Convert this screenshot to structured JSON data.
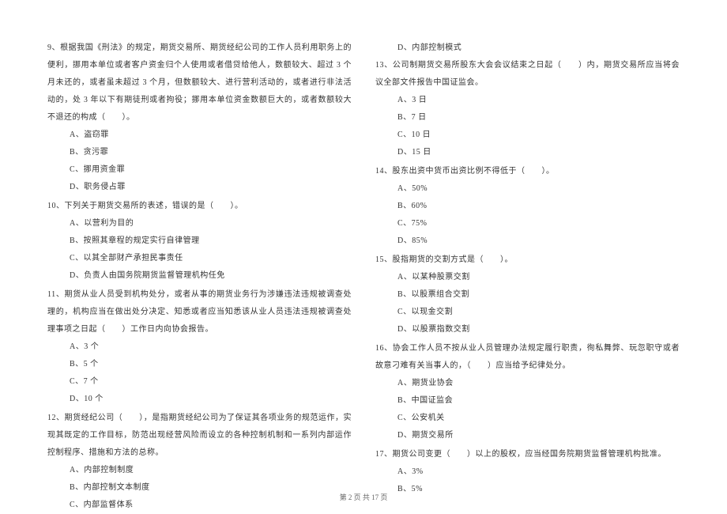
{
  "left_column": {
    "q9": {
      "text": "9、根据我国《刑法》的规定，期货交易所、期货经纪公司的工作人员利用职务上的便利，挪用本单位或者客户资金归个人使用或者借贷给他人，数额较大、超过 3 个月未还的，或者虽未超过 3 个月，但数额较大、进行营利活动的，或者进行非法活动的，处 3 年以下有期徒刑或者拘役；挪用本单位资金数额巨大的，或者数额较大不退还的构成（　　）。",
      "options": {
        "a": "A、盗窃罪",
        "b": "B、贪污罪",
        "c": "C、挪用资金罪",
        "d": "D、职务侵占罪"
      }
    },
    "q10": {
      "text": "10、下列关于期货交易所的表述，错误的是（　　）。",
      "options": {
        "a": "A、以营利为目的",
        "b": "B、按照其章程的规定实行自律管理",
        "c": "C、以其全部财产承担民事责任",
        "d": "D、负责人由国务院期货监督管理机构任免"
      }
    },
    "q11": {
      "text": "11、期货从业人员受到机构处分，或者从事的期货业务行为涉嫌违法违规被调查处理的，机构应当在做出处分决定、知悉或者应当知悉该从业人员违法违规被调查处理事项之日起（　　）工作日内向协会报告。",
      "options": {
        "a": "A、3 个",
        "b": "B、5 个",
        "c": "C、7 个",
        "d": "D、10 个"
      }
    },
    "q12": {
      "text": "12、期货经纪公司（　　），是指期货经纪公司为了保证其各项业务的规范运作，实现其既定的工作目标，防范出现经营风险而设立的各种控制机制和一系列内部运作控制程序、措施和方法的总称。",
      "options": {
        "a": "A、内部控制制度",
        "b": "B、内部控制文本制度",
        "c": "C、内部监督体系"
      }
    }
  },
  "right_column": {
    "q12d": "D、内部控制模式",
    "q13": {
      "text": "13、公司制期货交易所股东大会会议结束之日起（　　）内，期货交易所应当将会议全部文件报告中国证监会。",
      "options": {
        "a": "A、3 日",
        "b": "B、7 日",
        "c": "C、10 日",
        "d": "D、15 日"
      }
    },
    "q14": {
      "text": "14、股东出资中货币出资比例不得低于（　　）。",
      "options": {
        "a": "A、50%",
        "b": "B、60%",
        "c": "C、75%",
        "d": "D、85%"
      }
    },
    "q15": {
      "text": "15、股指期货的交割方式是（　　）。",
      "options": {
        "a": "A、以某种股票交割",
        "b": "B、以股票组合交割",
        "c": "C、以现金交割",
        "d": "D、以股票指数交割"
      }
    },
    "q16": {
      "text": "16、协会工作人员不按从业人员管理办法规定履行职责，徇私舞弊、玩忽职守或者故意刁难有关当事人的，（　　）应当给予纪律处分。",
      "options": {
        "a": "A、期货业协会",
        "b": "B、中国证监会",
        "c": "C、公安机关",
        "d": "D、期货交易所"
      }
    },
    "q17": {
      "text": "17、期货公司变更（　　）以上的股权，应当经国务院期货监督管理机构批准。",
      "options": {
        "a": "A、3%",
        "b": "B、5%"
      }
    }
  },
  "footer": "第 2 页 共 17 页"
}
